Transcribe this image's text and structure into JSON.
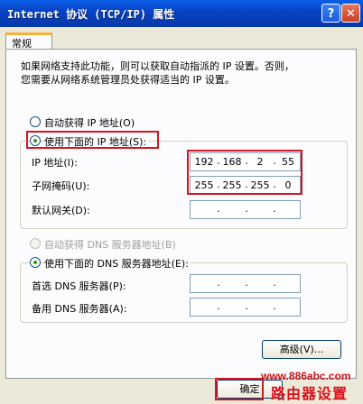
{
  "window": {
    "title": "Internet 协议 (TCP/IP) 属性",
    "help_glyph": "?",
    "close_glyph": "✕"
  },
  "tabs": [
    {
      "label": "常规"
    }
  ],
  "description": [
    "如果网络支持此功能，则可以获取自动指派的 IP 设置。否则，",
    "您需要从网络系统管理员处获得适当的 IP 设置。"
  ],
  "ip_mode": {
    "auto": {
      "label": "自动获得 IP 地址(O)",
      "selected": false
    },
    "manual": {
      "label": "使用下面的 IP 地址(S):",
      "selected": true
    }
  },
  "ip_fields": {
    "ip_address": {
      "label": "IP 地址(I):",
      "octets": [
        "192",
        "168",
        "2",
        "55"
      ]
    },
    "subnet_mask": {
      "label": "子网掩码(U):",
      "octets": [
        "255",
        "255",
        "255",
        "0"
      ]
    },
    "gateway": {
      "label": "默认网关(D):",
      "octets": [
        "",
        "",
        "",
        ""
      ]
    }
  },
  "dns_mode": {
    "auto": {
      "label": "自动获得 DNS 服务器地址(B)",
      "selected": false,
      "enabled": false
    },
    "manual": {
      "label": "使用下面的 DNS 服务器地址(E):",
      "selected": true
    }
  },
  "dns_fields": {
    "preferred": {
      "label": "首选 DNS 服务器(P):",
      "octets": [
        "",
        "",
        "",
        ""
      ]
    },
    "alternate": {
      "label": "备用 DNS 服务器(A):",
      "octets": [
        "",
        "",
        "",
        ""
      ]
    }
  },
  "buttons": {
    "advanced": "高级(V)...",
    "ok": "确定"
  },
  "watermark": {
    "url": "www.886abc.com",
    "name": "路由器设置"
  },
  "colors": {
    "highlight": "#d4141f",
    "titlebar": "#0842c6"
  }
}
